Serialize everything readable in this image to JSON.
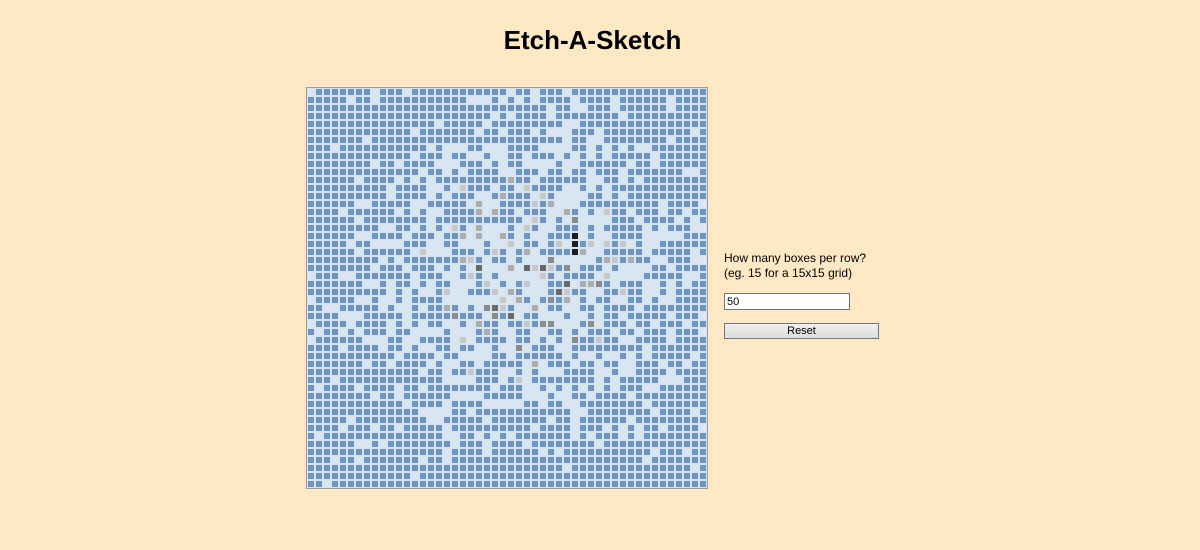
{
  "title": "Etch-A-Sketch",
  "controls": {
    "prompt_line_1": "How many boxes per row?",
    "prompt_line_2": "(eg. 15 for a 15x15 grid)",
    "input_value": "50",
    "reset_label": "Reset"
  },
  "grid": {
    "boxes_per_row": 50,
    "base_color": "#6f96c0",
    "blank_color": "#dbe7f4",
    "shade_colors": [
      "#c8c8c8",
      "#aeaeae",
      "#8c8c8c",
      "#6a6a6a",
      "#1e1e1e"
    ]
  }
}
